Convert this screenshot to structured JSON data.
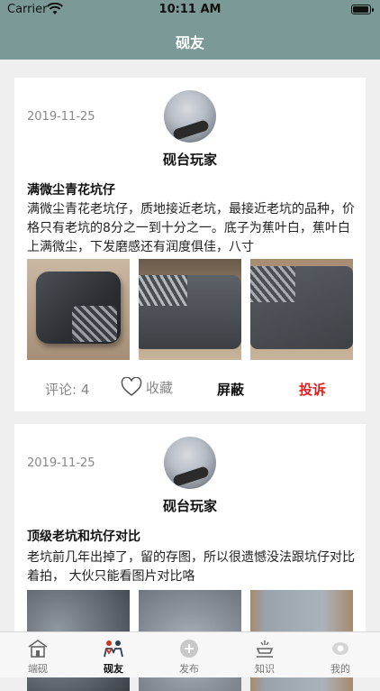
{
  "status": {
    "carrier": "Carrier",
    "time": "10:11 AM",
    "battery_level": 1.0
  },
  "nav": {
    "title": "砚友"
  },
  "posts": [
    {
      "date": "2019-11-25",
      "username": "砚台玩家",
      "title": "满微尘青花坑仔",
      "body": "满微尘青花老坑仔，质地接近老坑，最接近老坑的品种，价格只有老坑的8分之一到十分之一。底子为蕉叶白，蕉叶白上满微尘，下发磨感还有润度俱佳，八寸",
      "comments_label": "评论: 4",
      "favorite_label": "收藏",
      "block_label": "屏蔽",
      "report_label": "投诉"
    },
    {
      "date": "2019-11-25",
      "username": "砚台玩家",
      "title": "顶级老坑和坑仔对比",
      "body": "老坑前几年出掉了，留的存图，所以很遗憾没法跟坑仔对比着拍， 大伙只能看图片对比咯"
    }
  ],
  "tabs": [
    {
      "label": "端砚",
      "icon": "temple-icon"
    },
    {
      "label": "砚友",
      "icon": "friends-icon"
    },
    {
      "label": "发布",
      "icon": "plus-circle-icon"
    },
    {
      "label": "知识",
      "icon": "knowledge-icon"
    },
    {
      "label": "我的",
      "icon": "profile-icon"
    }
  ],
  "colors": {
    "header": "#7b9a97",
    "report": "#e01e1e"
  }
}
